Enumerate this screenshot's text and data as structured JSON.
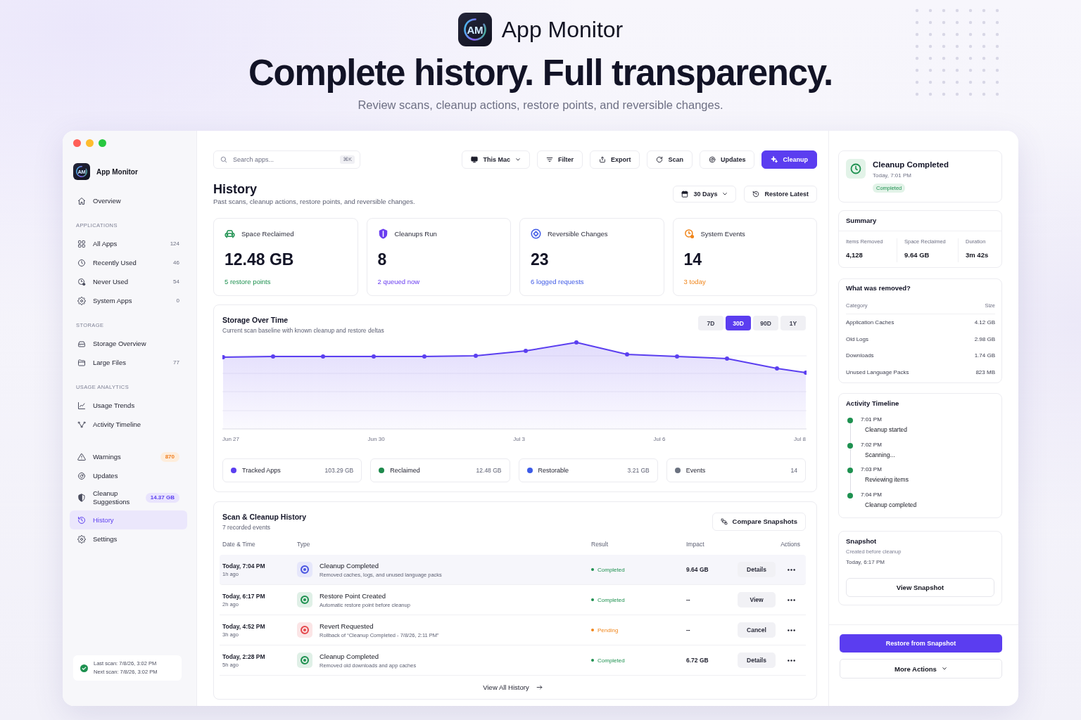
{
  "hero": {
    "logo_text": "AM",
    "app_name": "App Monitor",
    "headline": "Complete history. Full transparency.",
    "subtitle": "Review scans, cleanup actions, restore points, and reversible changes."
  },
  "sidebar": {
    "logo_text": "AM",
    "app_name": "App Monitor",
    "groups": [
      {
        "items": [
          {
            "label": "Overview",
            "selected": false
          }
        ]
      },
      {
        "heading": "APPLICATIONS",
        "items": [
          {
            "label": "All Apps",
            "count": "124",
            "selected": false
          },
          {
            "label": "Recently Used",
            "count": "46",
            "selected": false
          },
          {
            "label": "Never Used",
            "count": "54",
            "selected": false
          },
          {
            "label": "System Apps",
            "count": "0",
            "selected": false
          }
        ]
      },
      {
        "heading": "STORAGE",
        "items": [
          {
            "label": "Storage Overview",
            "selected": false
          },
          {
            "label": "Large Files",
            "count": "77",
            "selected": false
          }
        ]
      },
      {
        "heading": "USAGE ANALYTICS",
        "items": [
          {
            "label": "Usage Trends",
            "selected": false
          },
          {
            "label": "Activity Timeline",
            "selected": false
          }
        ]
      },
      {
        "items": [
          {
            "label": "Warnings",
            "badge": {
              "text": "870",
              "kind": "warning"
            },
            "selected": false
          },
          {
            "label": "Updates",
            "selected": false
          },
          {
            "label": "Cleanup Suggestions",
            "badge": {
              "text": "14.37 GB",
              "kind": "accent"
            },
            "selected": false
          },
          {
            "label": "History",
            "selected": true
          },
          {
            "label": "Settings",
            "selected": false
          }
        ]
      }
    ],
    "scan_status": {
      "last": "Last scan: 7/8/26, 3:02 PM",
      "next": "Next scan: 7/8/26, 3:02 PM"
    }
  },
  "toolbar": {
    "search": {
      "placeholder": "Search apps...",
      "shortcut": "⌘K"
    },
    "buttons": [
      {
        "label": "This Mac",
        "kind": "dropdown"
      },
      {
        "label": "Filter",
        "kind": "default"
      },
      {
        "label": "Export",
        "kind": "default"
      },
      {
        "label": "Scan",
        "kind": "default"
      },
      {
        "label": "Updates",
        "kind": "default"
      },
      {
        "label": "Cleanup",
        "kind": "primary"
      }
    ]
  },
  "page": {
    "title": "History",
    "subtitle": "Past scans, cleanup actions, restore points, and reversible changes.",
    "range": "30 Days",
    "restore_button": "Restore Latest"
  },
  "stats": [
    {
      "label": "Space Reclaimed",
      "value": "12.48 GB",
      "note": "5 restore points",
      "color": "#1e9150"
    },
    {
      "label": "Cleanups Run",
      "value": "8",
      "note": "2 queued now",
      "color": "#6a3df0"
    },
    {
      "label": "Reversible Changes",
      "value": "23",
      "note": "6 logged requests",
      "color": "#3f5ae6"
    },
    {
      "label": "System Events",
      "value": "14",
      "note": "3 today",
      "color": "#f0851a"
    }
  ],
  "storage_chart": {
    "title": "Storage Over Time",
    "subtitle": "Current scan baseline with known cleanup and restore deltas",
    "ranges": [
      {
        "label": "7D",
        "selected": false
      },
      {
        "label": "30D",
        "selected": true
      },
      {
        "label": "90D",
        "selected": false
      },
      {
        "label": "1Y",
        "selected": false
      }
    ],
    "x_labels": [
      "Jun 27",
      "Jun 30",
      "Jul 3",
      "Jul 6",
      "Jul 8"
    ],
    "legend": [
      {
        "name": "Tracked Apps",
        "value": "103.29 GB",
        "color": "#5b3ff0"
      },
      {
        "name": "Reclaimed",
        "value": "12.48 GB",
        "color": "#1e8a4c"
      },
      {
        "name": "Restorable",
        "value": "3.21 GB",
        "color": "#3c5be8"
      },
      {
        "name": "Events",
        "value": "14",
        "color": "#6b7280"
      }
    ]
  },
  "history": {
    "title": "Scan & Cleanup History",
    "subtitle": "7 recorded events",
    "compare_button": "Compare Snapshots",
    "columns": [
      "Date & Time",
      "Type",
      "Result",
      "Impact",
      "Actions"
    ],
    "rows": [
      {
        "date": "Today, 7:04 PM",
        "ago": "1h ago",
        "title": "Cleanup Completed",
        "description": "Removed caches, logs, and unused language packs",
        "color": "#4a55e0",
        "result": {
          "text": "Completed",
          "color": "#1e9150"
        },
        "impact": "9.64 GB",
        "action": "Details",
        "selected": true
      },
      {
        "date": "Today, 6:17 PM",
        "ago": "2h ago",
        "title": "Restore Point Created",
        "description": "Automatic restore point before cleanup",
        "color": "#1e9150",
        "result": {
          "text": "Completed",
          "color": "#1e9150"
        },
        "impact": "--",
        "action": "View",
        "selected": false
      },
      {
        "date": "Today, 4:52 PM",
        "ago": "3h ago",
        "title": "Revert Requested",
        "description": "Rollback of “Cleanup Completed - 7/8/26, 2:11 PM”",
        "color": "#e5484d",
        "result": {
          "text": "Pending",
          "color": "#f0851a"
        },
        "impact": "--",
        "action": "Cancel",
        "selected": false
      },
      {
        "date": "Today, 2:28 PM",
        "ago": "5h ago",
        "title": "Cleanup Completed",
        "description": "Removed old downloads and app caches",
        "color": "#1e9150",
        "result": {
          "text": "Completed",
          "color": "#1e9150"
        },
        "impact": "6.72 GB",
        "action": "Details",
        "selected": false
      }
    ],
    "footer_link": "View All History"
  },
  "detail": {
    "title": "Cleanup Completed",
    "time": "Today, 7:01 PM",
    "status": "Completed",
    "summary": {
      "title": "Summary",
      "stats": [
        {
          "label": "Items Removed",
          "value": "4,128"
        },
        {
          "label": "Space Reclaimed",
          "value": "9.64 GB"
        },
        {
          "label": "Duration",
          "value": "3m 42s"
        }
      ]
    },
    "removed": {
      "title": "What was removed?",
      "columns": [
        "Category",
        "Size"
      ],
      "rows": [
        {
          "category": "Application Caches",
          "size": "4.12 GB"
        },
        {
          "category": "Old Logs",
          "size": "2.98 GB"
        },
        {
          "category": "Downloads",
          "size": "1.74 GB"
        },
        {
          "category": "Unused Language Packs",
          "size": "823 MB"
        }
      ]
    },
    "timeline": {
      "title": "Activity Timeline",
      "events": [
        {
          "time": "7:01 PM",
          "text": "Cleanup started"
        },
        {
          "time": "7:02 PM",
          "text": "Scanning..."
        },
        {
          "time": "7:03 PM",
          "text": "Reviewing items"
        },
        {
          "time": "7:04 PM",
          "text": "Cleanup completed"
        }
      ]
    },
    "snapshot": {
      "title": "Snapshot",
      "note": "Created before cleanup",
      "time": "Today, 6:17 PM",
      "button": "View Snapshot"
    },
    "primary_button": "Restore from Snapshot",
    "more_button": "More Actions"
  }
}
